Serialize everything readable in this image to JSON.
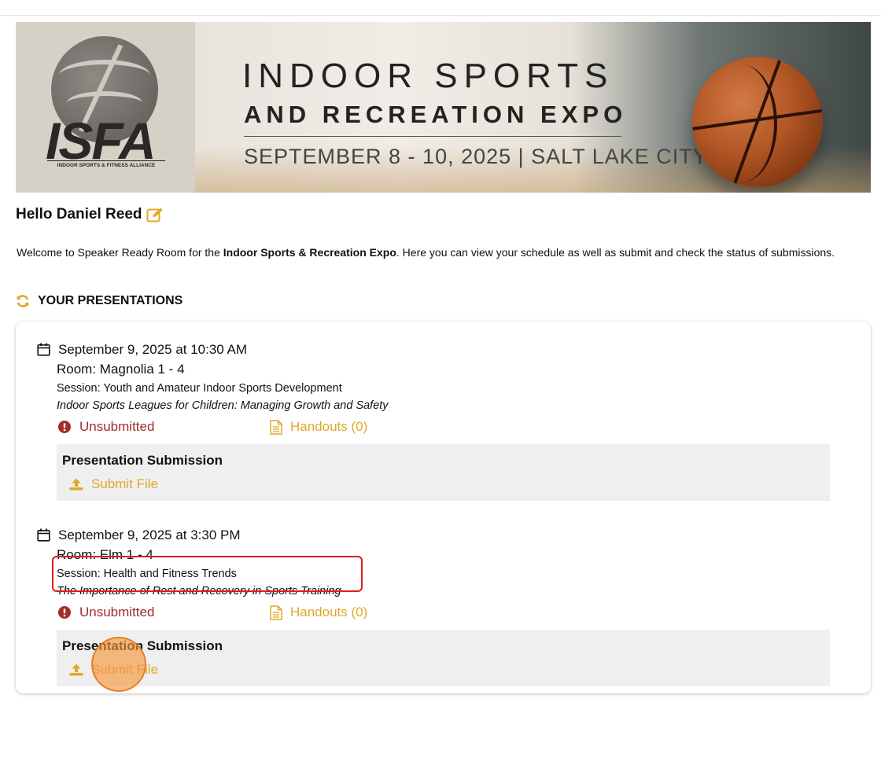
{
  "banner": {
    "logo_text": "ISFA",
    "logo_subtext": "INDOOR SPORTS & FITNESS ALLIANCE",
    "title_line1": "INDOOR SPORTS",
    "title_line2": "AND RECREATION EXPO",
    "date_line": "SEPTEMBER 8 - 10, 2025 | SALT LAKE CITY"
  },
  "greeting": {
    "text": "Hello Daniel Reed",
    "edit_icon": "edit-icon"
  },
  "welcome": {
    "prefix": "Welcome to Speaker Ready Room for the ",
    "event_name": "Indoor Sports & Recreation Expo",
    "suffix": ". Here you can view your schedule as well as submit and check the status of submissions."
  },
  "section": {
    "title": "YOUR PRESENTATIONS",
    "icon": "refresh-icon"
  },
  "presentations": [
    {
      "datetime": "September 9, 2025 at 10:30 AM",
      "room": "Room: Magnolia 1 - 4",
      "session": "Session: Youth and Amateur Indoor Sports Development",
      "title": "Indoor Sports Leagues for Children: Managing Growth and Safety",
      "status": "Unsubmitted",
      "handouts": "Handouts (0)",
      "submission_title": "Presentation Submission",
      "submit_label": "Submit File"
    },
    {
      "datetime": "September 9, 2025 at 3:30 PM",
      "room": "Room: Elm 1 - 4",
      "session": "Session: Health and Fitness Trends",
      "title": "The Importance of Rest and Recovery in Sports Training",
      "status": "Unsubmitted",
      "handouts": "Handouts (0)",
      "submission_title": "Presentation Submission",
      "submit_label": "Submit File"
    }
  ],
  "colors": {
    "accent": "#e0a828",
    "status_error": "#a12d2d",
    "highlight_box": "#d9201c",
    "click_indicator": "#f4963c"
  }
}
